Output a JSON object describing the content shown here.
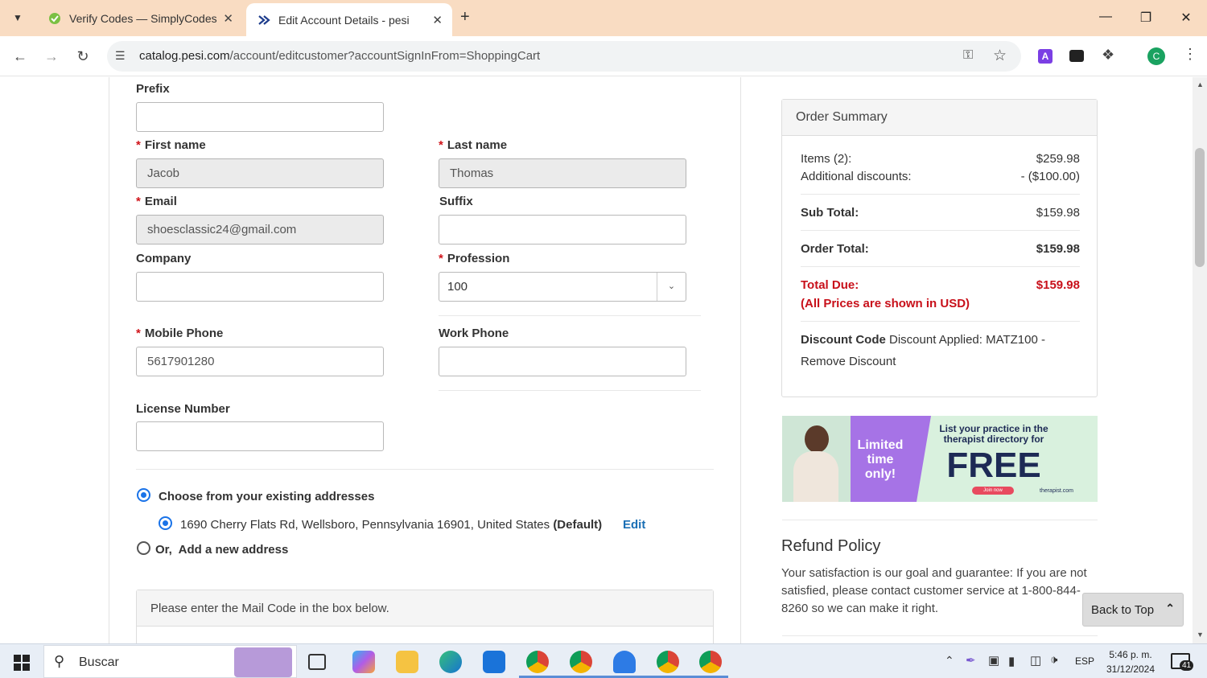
{
  "browser": {
    "tabs": [
      {
        "title": "Verify Codes — SimplyCodes"
      },
      {
        "title": "Edit Account Details - pesi"
      }
    ],
    "url_host": "catalog.pesi.com",
    "url_path": "/account/editcustomer?accountSignInFrom=ShoppingCart",
    "profile_initial": "C"
  },
  "form": {
    "prefix_label": "Prefix",
    "prefix_value": "",
    "first_name_label": "First name",
    "first_name_value": "Jacob",
    "last_name_label": "Last name",
    "last_name_value": "Thomas",
    "email_label": "Email",
    "email_value": "shoesclassic24@gmail.com",
    "suffix_label": "Suffix",
    "suffix_value": "",
    "company_label": "Company",
    "company_value": "",
    "profession_label": "Profession",
    "profession_value": "100",
    "mobile_label": "Mobile Phone",
    "mobile_value": "5617901280",
    "work_label": "Work Phone",
    "work_value": "",
    "license_label": "License Number",
    "license_value": "",
    "required_mark": "*"
  },
  "address": {
    "choose_existing_label": "Choose from your existing addresses",
    "existing_address": "1690 Cherry Flats Rd, Wellsboro, Pennsylvania 16901, United States",
    "default_tag": "(Default)",
    "edit_link": "Edit",
    "add_new_label": "Or,  Add a new address",
    "mail_code_prompt": "Please enter the Mail Code in the box below."
  },
  "summary": {
    "title": "Order Summary",
    "items_label": "Items (2):",
    "items_value": "$259.98",
    "discounts_label": "Additional discounts:",
    "discounts_value": "- ($100.00)",
    "subtotal_label": "Sub Total:",
    "subtotal_value": "$159.98",
    "order_total_label": "Order Total:",
    "order_total_value": "$159.98",
    "total_due_label": "Total Due:",
    "total_due_value": "$159.98",
    "usd_note": "(All Prices are shown in USD)",
    "discount_code_label": "Discount Code",
    "discount_applied": "Discount Applied: MATZ100 -",
    "remove_discount": "Remove Discount"
  },
  "ad": {
    "limited": "Limited time only!",
    "headline": "List your practice in the therapist directory for",
    "free": "FREE",
    "join": "Join now",
    "brand": "therapist.com"
  },
  "refund": {
    "title": "Refund Policy",
    "text": "Your satisfaction is our goal and guarantee: If you are not satisfied, please contact customer service at 1-800-844-8260 so we can make it right."
  },
  "back_to_top": "Back to Top",
  "taskbar": {
    "search_placeholder": "Buscar",
    "lang": "ESP",
    "time": "5:46 p. m.",
    "date": "31/12/2024",
    "notif_count": "41"
  },
  "colors": {
    "required": "#d0141a",
    "link": "#1a6fb5",
    "total_due": "#c8101a",
    "tabbar": "#f9dcc2"
  }
}
